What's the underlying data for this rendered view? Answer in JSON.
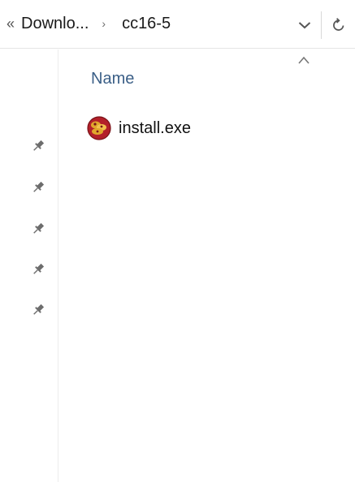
{
  "address_bar": {
    "overflow_icon": "double-chevron-left-icon",
    "crumbs": [
      "Downlo...",
      "cc16-5"
    ],
    "separator_icon": "chevron-right-icon",
    "dropdown_icon": "chevron-down-icon",
    "refresh_icon": "refresh-icon"
  },
  "nav_pane": {
    "pins": [
      {
        "icon": "pin-icon"
      },
      {
        "icon": "pin-icon"
      },
      {
        "icon": "pin-icon"
      },
      {
        "icon": "pin-icon"
      },
      {
        "icon": "pin-icon"
      }
    ]
  },
  "file_list": {
    "sort_icon": "sort-ascending-icon",
    "columns": [
      {
        "label": "Name"
      }
    ],
    "files": [
      {
        "name": "install.exe",
        "icon": "installer-exe-icon"
      }
    ]
  },
  "colors": {
    "header_text": "#3b5f87",
    "icon_gray": "#6d6d6d",
    "file_icon_red": "#b3202a",
    "file_icon_gold": "#e0a72c"
  }
}
